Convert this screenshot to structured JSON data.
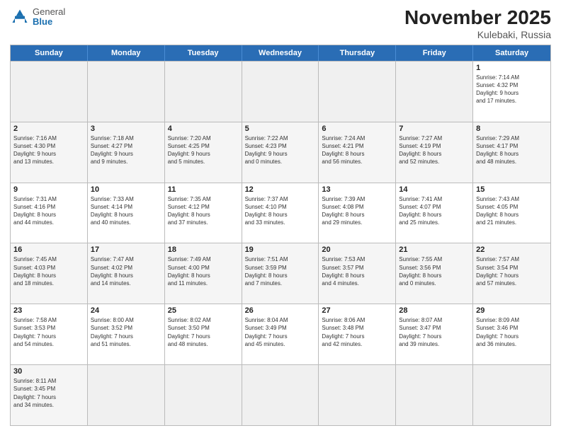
{
  "header": {
    "logo_general": "General",
    "logo_blue": "Blue",
    "month_title": "November 2025",
    "location": "Kulebaki, Russia"
  },
  "days_of_week": [
    "Sunday",
    "Monday",
    "Tuesday",
    "Wednesday",
    "Thursday",
    "Friday",
    "Saturday"
  ],
  "rows": [
    [
      {
        "day": "",
        "info": "",
        "empty": true
      },
      {
        "day": "",
        "info": "",
        "empty": true
      },
      {
        "day": "",
        "info": "",
        "empty": true
      },
      {
        "day": "",
        "info": "",
        "empty": true
      },
      {
        "day": "",
        "info": "",
        "empty": true
      },
      {
        "day": "",
        "info": "",
        "empty": true
      },
      {
        "day": "1",
        "info": "Sunrise: 7:14 AM\nSunset: 4:32 PM\nDaylight: 9 hours\nand 17 minutes."
      }
    ],
    [
      {
        "day": "2",
        "info": "Sunrise: 7:16 AM\nSunset: 4:30 PM\nDaylight: 9 hours\nand 13 minutes."
      },
      {
        "day": "3",
        "info": "Sunrise: 7:18 AM\nSunset: 4:27 PM\nDaylight: 9 hours\nand 9 minutes."
      },
      {
        "day": "4",
        "info": "Sunrise: 7:20 AM\nSunset: 4:25 PM\nDaylight: 9 hours\nand 5 minutes."
      },
      {
        "day": "5",
        "info": "Sunrise: 7:22 AM\nSunset: 4:23 PM\nDaylight: 9 hours\nand 0 minutes."
      },
      {
        "day": "6",
        "info": "Sunrise: 7:24 AM\nSunset: 4:21 PM\nDaylight: 8 hours\nand 56 minutes."
      },
      {
        "day": "7",
        "info": "Sunrise: 7:27 AM\nSunset: 4:19 PM\nDaylight: 8 hours\nand 52 minutes."
      },
      {
        "day": "8",
        "info": "Sunrise: 7:29 AM\nSunset: 4:17 PM\nDaylight: 8 hours\nand 48 minutes."
      }
    ],
    [
      {
        "day": "9",
        "info": "Sunrise: 7:31 AM\nSunset: 4:16 PM\nDaylight: 8 hours\nand 44 minutes."
      },
      {
        "day": "10",
        "info": "Sunrise: 7:33 AM\nSunset: 4:14 PM\nDaylight: 8 hours\nand 40 minutes."
      },
      {
        "day": "11",
        "info": "Sunrise: 7:35 AM\nSunset: 4:12 PM\nDaylight: 8 hours\nand 37 minutes."
      },
      {
        "day": "12",
        "info": "Sunrise: 7:37 AM\nSunset: 4:10 PM\nDaylight: 8 hours\nand 33 minutes."
      },
      {
        "day": "13",
        "info": "Sunrise: 7:39 AM\nSunset: 4:08 PM\nDaylight: 8 hours\nand 29 minutes."
      },
      {
        "day": "14",
        "info": "Sunrise: 7:41 AM\nSunset: 4:07 PM\nDaylight: 8 hours\nand 25 minutes."
      },
      {
        "day": "15",
        "info": "Sunrise: 7:43 AM\nSunset: 4:05 PM\nDaylight: 8 hours\nand 21 minutes."
      }
    ],
    [
      {
        "day": "16",
        "info": "Sunrise: 7:45 AM\nSunset: 4:03 PM\nDaylight: 8 hours\nand 18 minutes."
      },
      {
        "day": "17",
        "info": "Sunrise: 7:47 AM\nSunset: 4:02 PM\nDaylight: 8 hours\nand 14 minutes."
      },
      {
        "day": "18",
        "info": "Sunrise: 7:49 AM\nSunset: 4:00 PM\nDaylight: 8 hours\nand 11 minutes."
      },
      {
        "day": "19",
        "info": "Sunrise: 7:51 AM\nSunset: 3:59 PM\nDaylight: 8 hours\nand 7 minutes."
      },
      {
        "day": "20",
        "info": "Sunrise: 7:53 AM\nSunset: 3:57 PM\nDaylight: 8 hours\nand 4 minutes."
      },
      {
        "day": "21",
        "info": "Sunrise: 7:55 AM\nSunset: 3:56 PM\nDaylight: 8 hours\nand 0 minutes."
      },
      {
        "day": "22",
        "info": "Sunrise: 7:57 AM\nSunset: 3:54 PM\nDaylight: 7 hours\nand 57 minutes."
      }
    ],
    [
      {
        "day": "23",
        "info": "Sunrise: 7:58 AM\nSunset: 3:53 PM\nDaylight: 7 hours\nand 54 minutes."
      },
      {
        "day": "24",
        "info": "Sunrise: 8:00 AM\nSunset: 3:52 PM\nDaylight: 7 hours\nand 51 minutes."
      },
      {
        "day": "25",
        "info": "Sunrise: 8:02 AM\nSunset: 3:50 PM\nDaylight: 7 hours\nand 48 minutes."
      },
      {
        "day": "26",
        "info": "Sunrise: 8:04 AM\nSunset: 3:49 PM\nDaylight: 7 hours\nand 45 minutes."
      },
      {
        "day": "27",
        "info": "Sunrise: 8:06 AM\nSunset: 3:48 PM\nDaylight: 7 hours\nand 42 minutes."
      },
      {
        "day": "28",
        "info": "Sunrise: 8:07 AM\nSunset: 3:47 PM\nDaylight: 7 hours\nand 39 minutes."
      },
      {
        "day": "29",
        "info": "Sunrise: 8:09 AM\nSunset: 3:46 PM\nDaylight: 7 hours\nand 36 minutes."
      }
    ],
    [
      {
        "day": "30",
        "info": "Sunrise: 8:11 AM\nSunset: 3:45 PM\nDaylight: 7 hours\nand 34 minutes."
      },
      {
        "day": "",
        "info": "",
        "empty": true
      },
      {
        "day": "",
        "info": "",
        "empty": true
      },
      {
        "day": "",
        "info": "",
        "empty": true
      },
      {
        "day": "",
        "info": "",
        "empty": true
      },
      {
        "day": "",
        "info": "",
        "empty": true
      },
      {
        "day": "",
        "info": "",
        "empty": true
      }
    ]
  ]
}
